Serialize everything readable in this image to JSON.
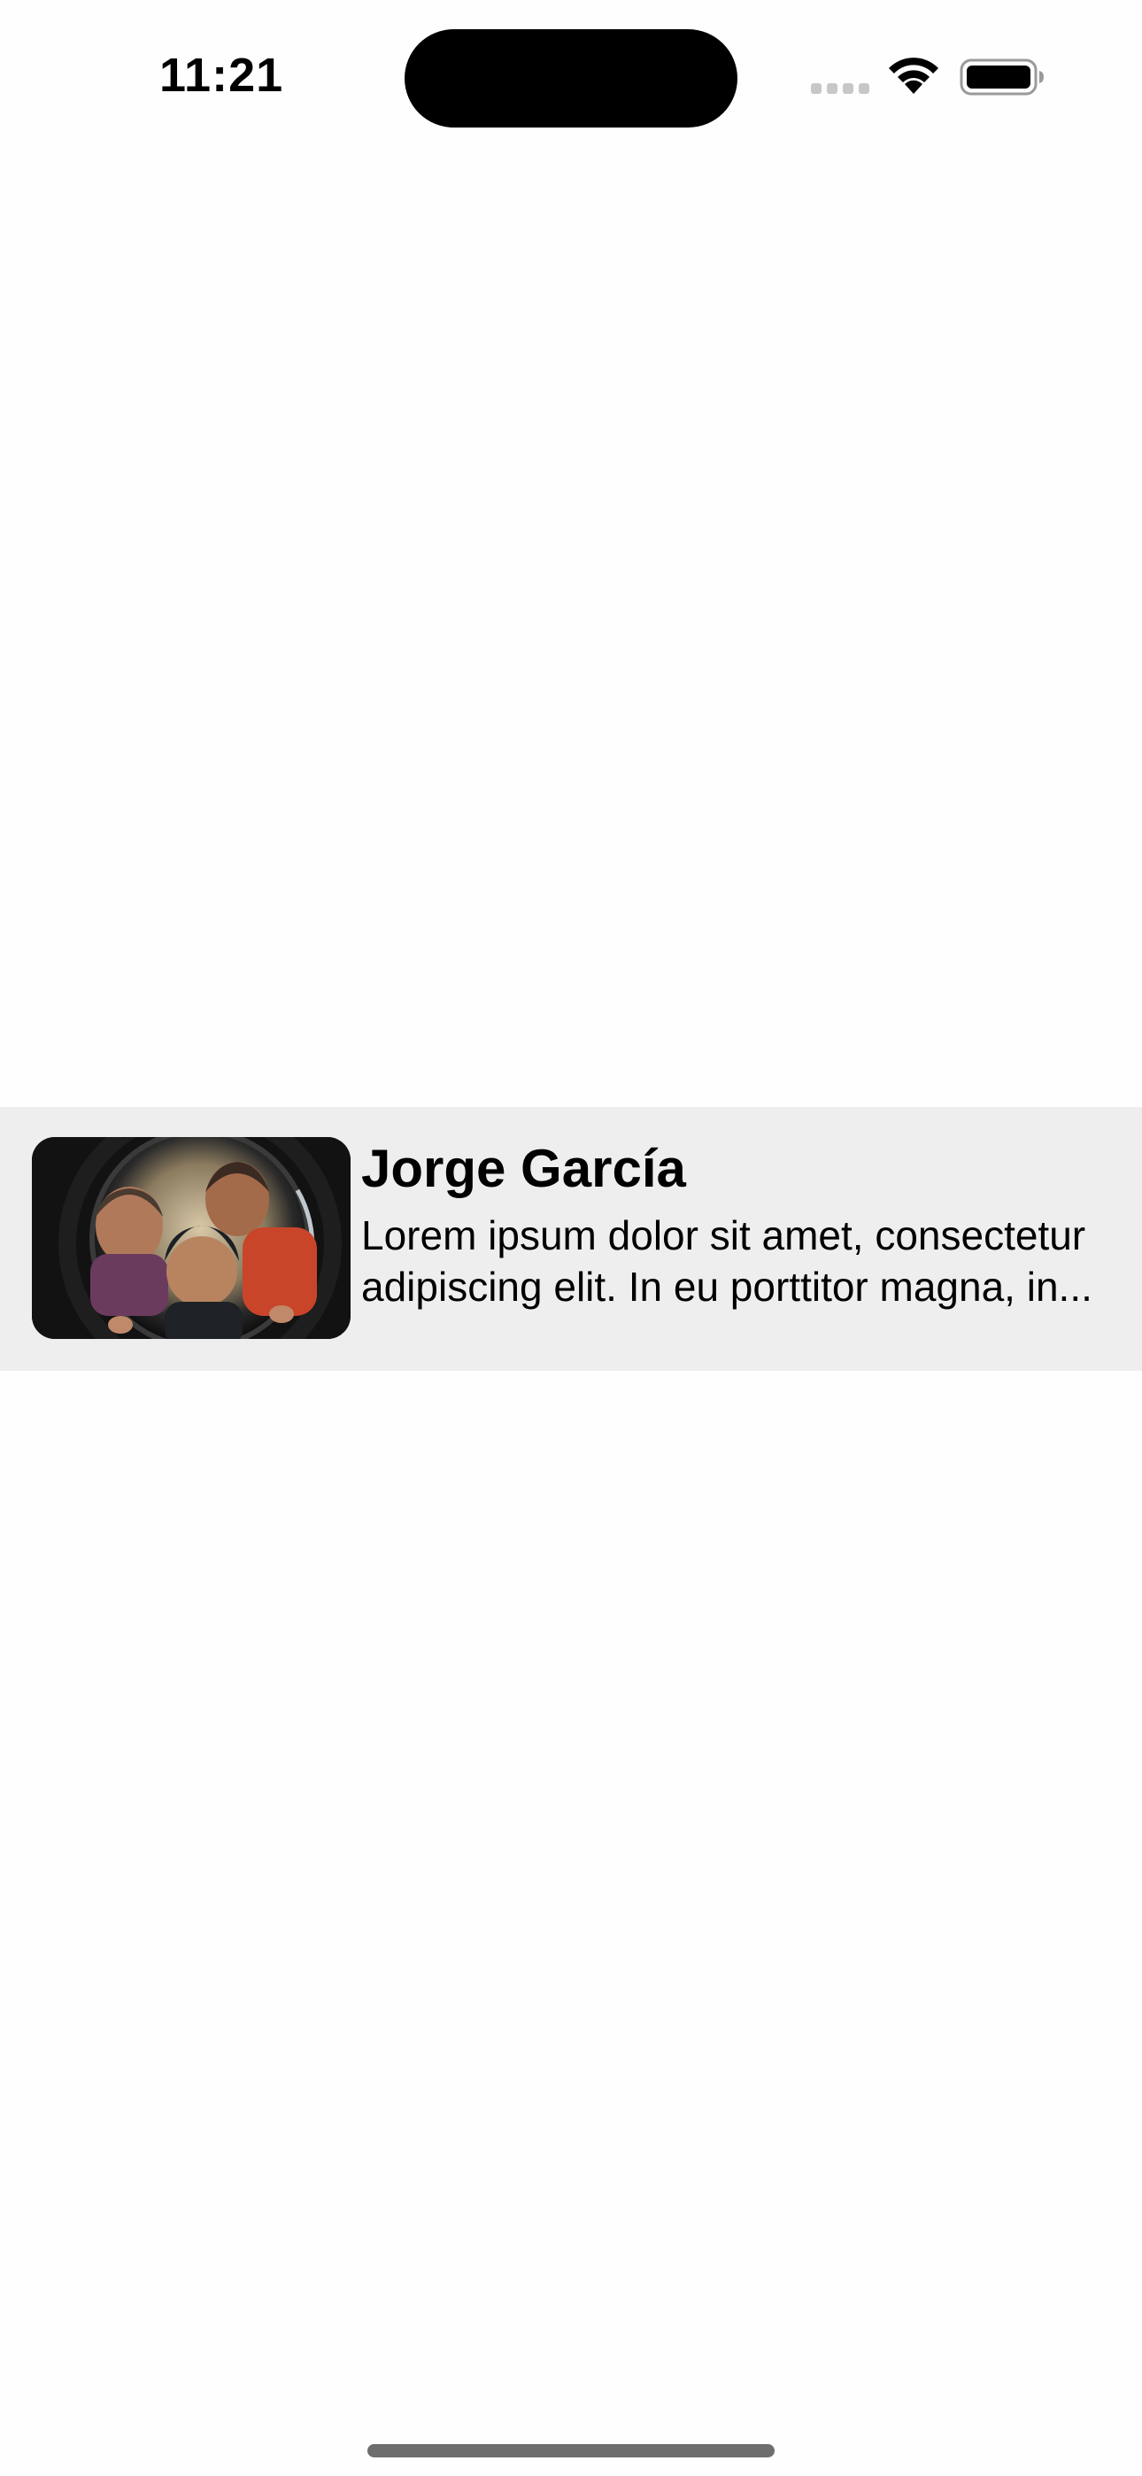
{
  "status_bar": {
    "time": "11:21",
    "signal_icon": "cellular-signal-icon",
    "wifi_icon": "wifi-icon",
    "battery_icon": "battery-icon"
  },
  "list": {
    "items": [
      {
        "title": "Jorge García",
        "body": "Lorem ipsum dolor sit amet, consectetur adipiscing elit. In eu porttitor magna, in...",
        "image": "children-looking-into-tube-photo"
      }
    ]
  },
  "colors": {
    "row_background": "#eeeeee",
    "page_background": "#fefefe",
    "text": "#000000"
  }
}
